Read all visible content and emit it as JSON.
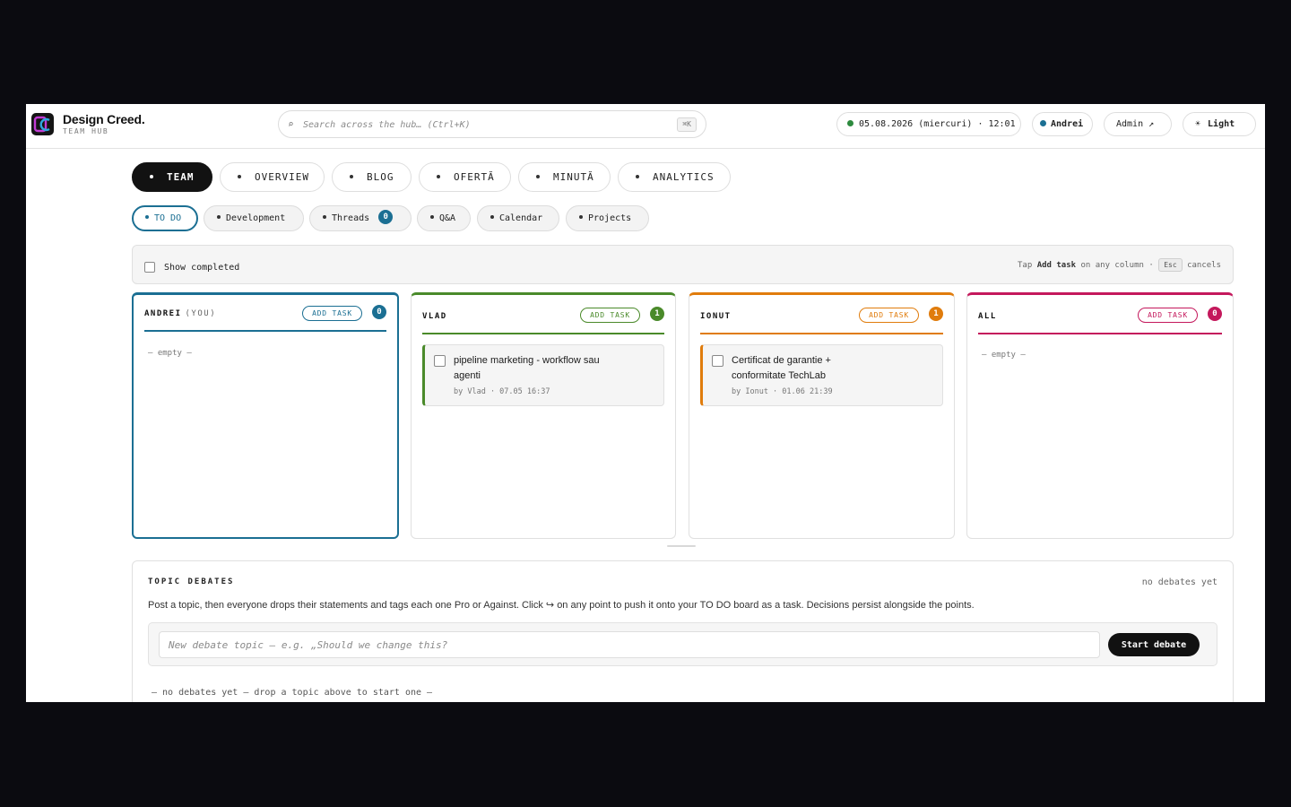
{
  "header": {
    "brand_name": "Design Creed.",
    "brand_sub": "TEAM HUB",
    "search_placeholder": "Search across the hub… (Ctrl+K)",
    "search_shortcut": "⌘K",
    "date_time": "05.08.2026 (miercuri) · 12:01",
    "user_name": "Andrei",
    "admin_label": "Admin ↗",
    "theme_label": "Light",
    "colors": {
      "status_green": "#2d8a3e",
      "user_blue": "#1b6f93"
    }
  },
  "main_tabs": [
    "TEAM",
    "OVERVIEW",
    "BLOG",
    "OFERTĂ",
    "MINUTĂ",
    "ANALYTICS"
  ],
  "sub_tabs": {
    "todo": "TO DO",
    "development": "Development",
    "threads": "Threads",
    "threads_count": "0",
    "qa": "Q&A",
    "calendar": "Calendar",
    "projects": "Projects"
  },
  "hint_bar": {
    "show_completed": "Show completed",
    "tap": "Tap",
    "add_task": "Add task",
    "on_any_column": "on any column ·",
    "esc": "Esc",
    "cancels": "cancels"
  },
  "columns": [
    {
      "name": "ANDREI",
      "you": "(YOU)",
      "add": "ADD TASK",
      "count": "0",
      "color": "#1b6f93",
      "empty": "— empty —"
    },
    {
      "name": "VLAD",
      "add": "ADD TASK",
      "count": "1",
      "color": "#4a8a2a",
      "task": {
        "title": "pipeline marketing - workflow sau agenti",
        "meta": "by Vlad · 07.05 16:37"
      }
    },
    {
      "name": "IONUT",
      "add": "ADD TASK",
      "count": "1",
      "color": "#e07c0c",
      "task": {
        "title": "Certificat de garantie + conformitate TechLab",
        "meta": "by Ionut · 01.06 21:39"
      }
    },
    {
      "name": "ALL",
      "add": "ADD TASK",
      "count": "0",
      "color": "#c4185c",
      "empty": "— empty —"
    }
  ],
  "debates": {
    "title": "TOPIC DEBATES",
    "status": "no debates yet",
    "description": "Post a topic, then everyone drops their statements and tags each one Pro or Against. Click ↪ on any point to push it onto your TO DO board as a task. Decisions persist alongside the points.",
    "input_placeholder": "New debate topic — e.g. „Should we change this?",
    "start_button": "Start debate",
    "empty": "— no debates yet — drop a topic above to start one —"
  }
}
